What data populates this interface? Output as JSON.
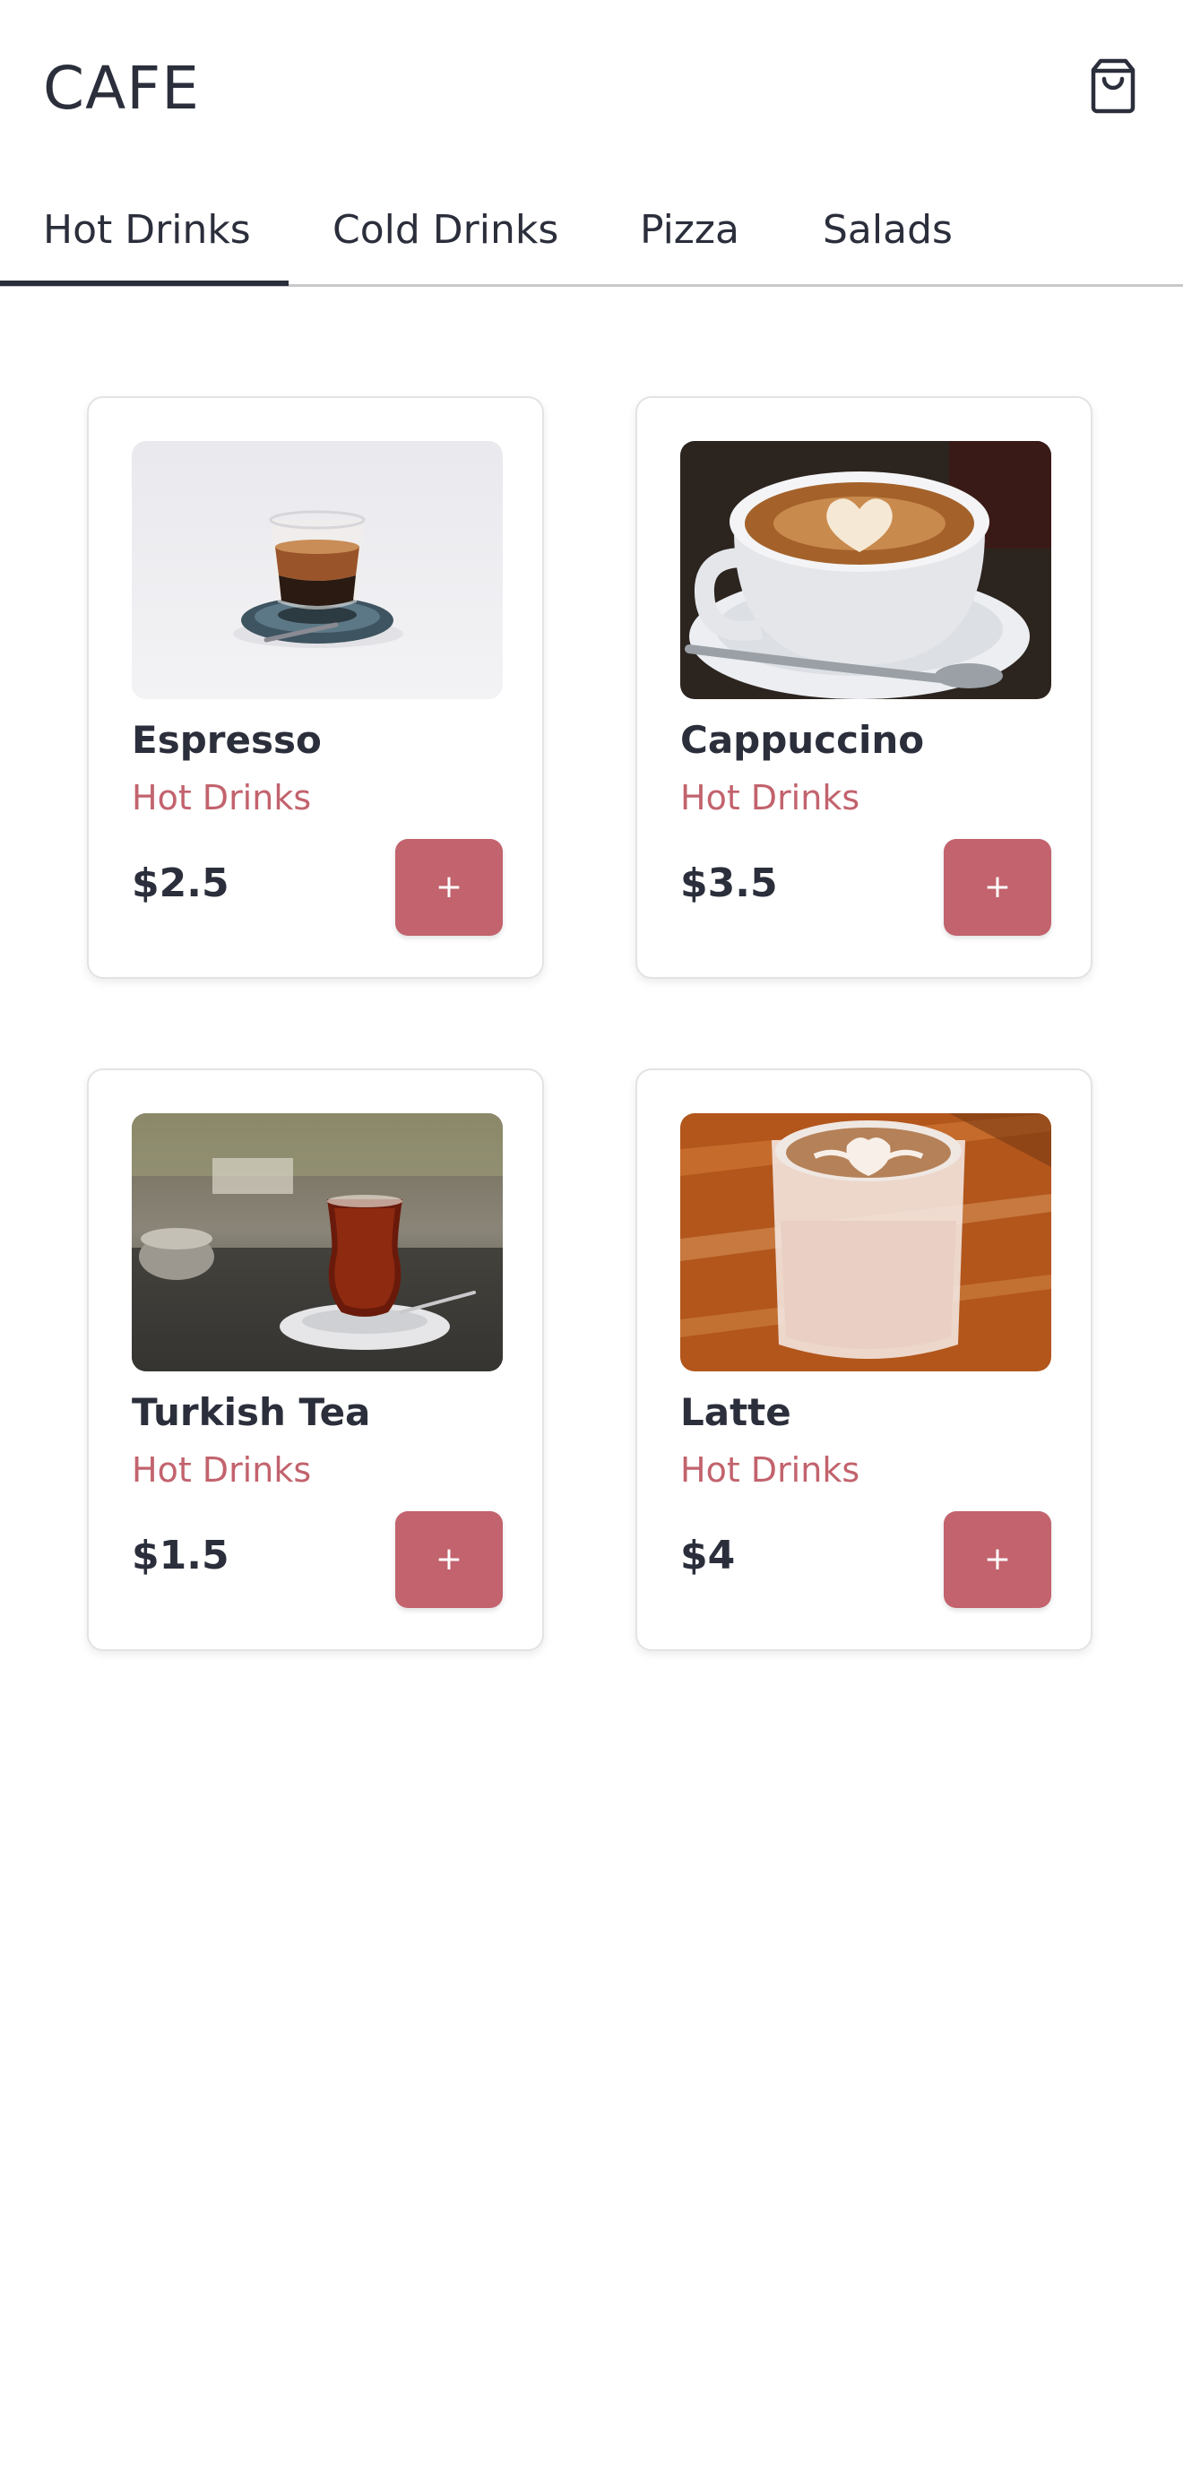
{
  "header": {
    "title": "CAFE",
    "cart_icon": "shopping-bag-icon"
  },
  "tabs": [
    {
      "label": "Hot Drinks",
      "active": true
    },
    {
      "label": "Cold Drinks",
      "active": false
    },
    {
      "label": "Pizza",
      "active": false
    },
    {
      "label": "Salads",
      "active": false
    }
  ],
  "products": [
    {
      "name": "Espresso",
      "category": "Hot Drinks",
      "price": "$2.5",
      "add_label": "+"
    },
    {
      "name": "Cappuccino",
      "category": "Hot Drinks",
      "price": "$3.5",
      "add_label": "+"
    },
    {
      "name": "Turkish Tea",
      "category": "Hot Drinks",
      "price": "$1.5",
      "add_label": "+"
    },
    {
      "name": "Latte",
      "category": "Hot Drinks",
      "price": "$4",
      "add_label": "+"
    }
  ],
  "colors": {
    "accent": "#c2636d",
    "text": "#2b2e3b",
    "card_border": "#e3e3e6"
  }
}
